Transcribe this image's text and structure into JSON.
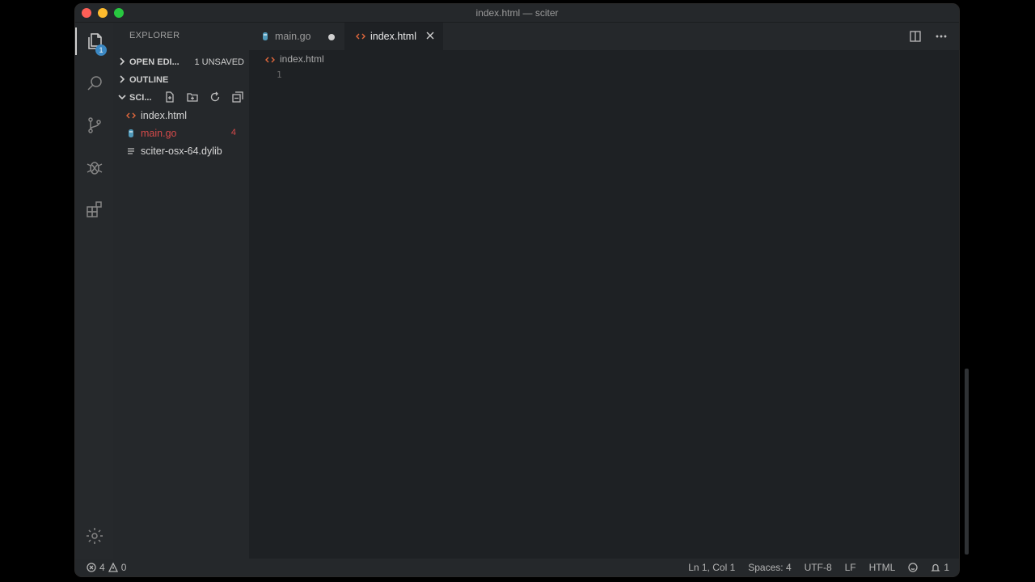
{
  "window": {
    "title": "index.html — sciter"
  },
  "activity": {
    "explorer_badge": "1"
  },
  "sidebar": {
    "title": "EXPLORER",
    "open_editors": {
      "label": "OPEN EDI...",
      "unsaved": "1 UNSAVED"
    },
    "outline": {
      "label": "OUTLINE"
    },
    "folder": {
      "label": "SCI..."
    },
    "files": [
      {
        "name": "index.html",
        "icon": "html-icon"
      },
      {
        "name": "main.go",
        "icon": "go-icon",
        "problems": "4"
      },
      {
        "name": "sciter-osx-64.dylib",
        "icon": "file-lines-icon"
      }
    ]
  },
  "tabs": [
    {
      "label": "main.go",
      "icon": "go-icon",
      "dirty": true
    },
    {
      "label": "index.html",
      "icon": "html-icon",
      "active": true
    }
  ],
  "breadcrumb": {
    "file": "index.html"
  },
  "editor": {
    "line_number": "1"
  },
  "statusbar": {
    "errors": "4",
    "warnings": "0",
    "position": "Ln 1, Col 1",
    "spaces": "Spaces: 4",
    "encoding": "UTF-8",
    "eol": "LF",
    "language": "HTML",
    "notifications": "1"
  },
  "colors": {
    "accent_badge": "#3b88c3",
    "error_text": "#d44a4a",
    "html_icon": "#e2683c",
    "go_icon": "#519aba"
  }
}
